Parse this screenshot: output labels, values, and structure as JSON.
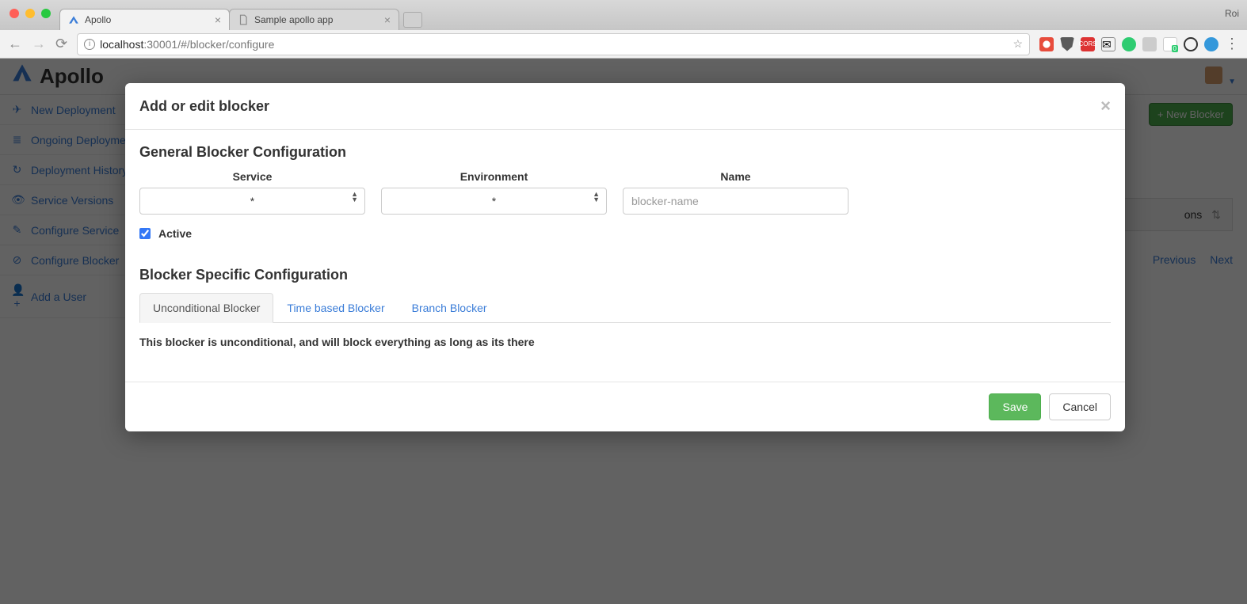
{
  "browser": {
    "tabs": [
      {
        "title": "Apollo"
      },
      {
        "title": "Sample apollo app"
      }
    ],
    "user_label": "Roi",
    "url_host": "localhost",
    "url_port": ":30001",
    "url_path": "/#/blocker/configure"
  },
  "app": {
    "brand": "Apollo",
    "sidebar": {
      "new_deployment": "New Deployment",
      "ongoing": "Ongoing Deployments",
      "history": "Deployment History",
      "versions": "Service Versions",
      "configure_service": "Configure Service",
      "configure_blocker": "Configure Blocker",
      "add_user": "Add a User"
    },
    "new_blocker_btn": "New Blocker",
    "grid_header_col": "ons",
    "pager_prev": "Previous",
    "pager_next": "Next"
  },
  "modal": {
    "title": "Add or edit blocker",
    "general_heading": "General Blocker Configuration",
    "service_label": "Service",
    "service_value": "*",
    "env_label": "Environment",
    "env_value": "*",
    "name_label": "Name",
    "name_placeholder": "blocker-name",
    "active_label": "Active",
    "specific_heading": "Blocker Specific Configuration",
    "tab_unconditional": "Unconditional Blocker",
    "tab_time": "Time based Blocker",
    "tab_branch": "Branch Blocker",
    "tab_desc": "This blocker is unconditional, and will block everything as long as its there",
    "save": "Save",
    "cancel": "Cancel"
  }
}
